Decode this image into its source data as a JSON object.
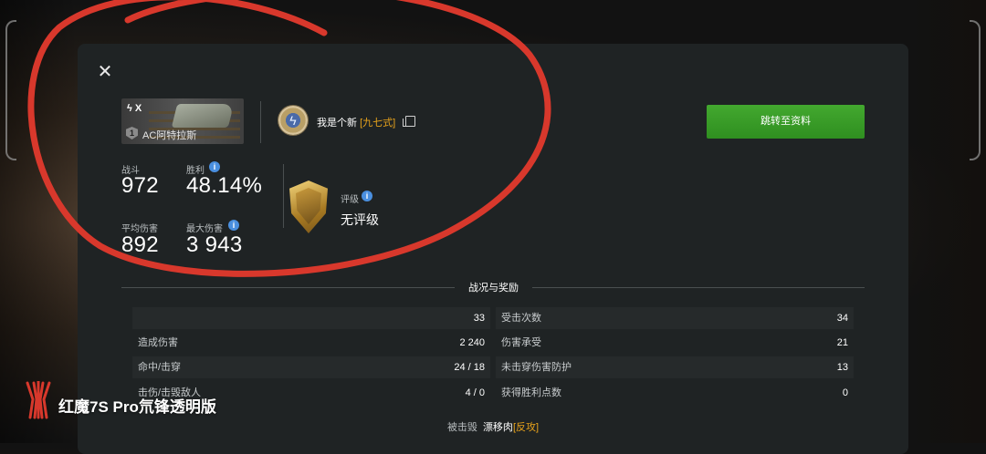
{
  "dialog": {
    "close_icon": "close-icon",
    "tank": {
      "tier": "X",
      "badge": "1",
      "name": "AC阿特拉斯"
    },
    "player": {
      "name": "我是个新 ",
      "clan": "[九七式]"
    },
    "goto_button": "跳转至资料",
    "stats": {
      "battles_label": "战斗",
      "battles_value": "972",
      "wins_label": "胜利",
      "wins_value": "48.14%",
      "avg_damage_label": "平均伤害",
      "avg_damage_value": "892",
      "max_damage_label": "最大伤害",
      "max_damage_value": "3 943"
    },
    "rating": {
      "label": "评级",
      "value": "无评级"
    },
    "section_title": "战况与奖励",
    "left_rows": [
      {
        "label": "",
        "value": "33"
      },
      {
        "label": "造成伤害",
        "value": "2 240"
      },
      {
        "label": "命中/击穿",
        "value": "24 / 18"
      },
      {
        "label": "击伤/击毁敌人",
        "value": "4 / 0"
      }
    ],
    "right_rows": [
      {
        "label": "受击次数",
        "value": "34"
      },
      {
        "label": "伤害承受",
        "value": "21"
      },
      {
        "label": "未击穿伤害防护",
        "value": "13"
      },
      {
        "label": "获得胜利点数",
        "value": "0"
      }
    ],
    "killed_by": {
      "label": "被击毁",
      "name": "漂移肉",
      "clan": "[反攻]"
    }
  },
  "watermark": {
    "text": "红魔7S Pro氘锋透明版"
  },
  "colors": {
    "accent_green": "#3a9d27",
    "clan_orange": "#e8a31b",
    "info_blue": "#4a8fdf",
    "annotation_red": "#d8382c"
  }
}
